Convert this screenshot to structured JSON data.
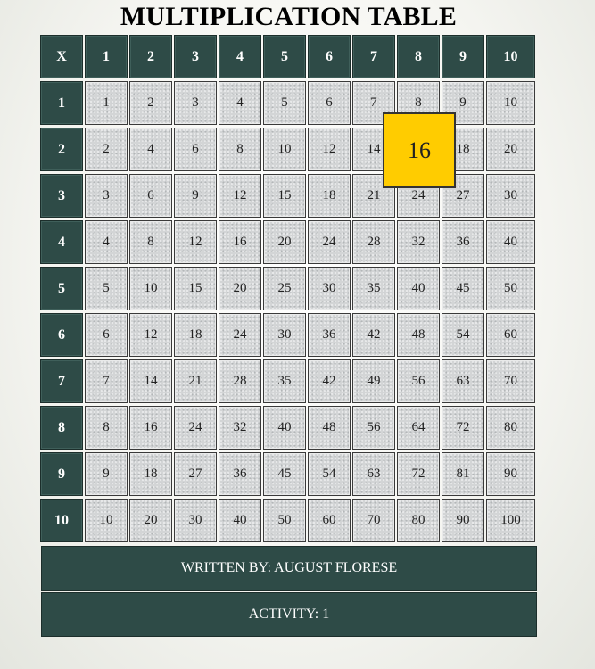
{
  "title": "MULTIPLICATION TABLE",
  "corner_label": "X",
  "column_headers": [
    "1",
    "2",
    "3",
    "4",
    "5",
    "6",
    "7",
    "8",
    "9",
    "10"
  ],
  "row_headers": [
    "1",
    "2",
    "3",
    "4",
    "5",
    "6",
    "7",
    "8",
    "9",
    "10"
  ],
  "rows": [
    [
      "1",
      "2",
      "3",
      "4",
      "5",
      "6",
      "7",
      "8",
      "9",
      "10"
    ],
    [
      "2",
      "4",
      "6",
      "8",
      "10",
      "12",
      "14",
      "16",
      "18",
      "20"
    ],
    [
      "3",
      "6",
      "9",
      "12",
      "15",
      "18",
      "21",
      "24",
      "27",
      "30"
    ],
    [
      "4",
      "8",
      "12",
      "16",
      "20",
      "24",
      "28",
      "32",
      "36",
      "40"
    ],
    [
      "5",
      "10",
      "15",
      "20",
      "25",
      "30",
      "35",
      "40",
      "45",
      "50"
    ],
    [
      "6",
      "12",
      "18",
      "24",
      "30",
      "36",
      "42",
      "48",
      "54",
      "60"
    ],
    [
      "7",
      "14",
      "21",
      "28",
      "35",
      "42",
      "49",
      "56",
      "63",
      "70"
    ],
    [
      "8",
      "16",
      "24",
      "32",
      "40",
      "48",
      "56",
      "64",
      "72",
      "80"
    ],
    [
      "9",
      "18",
      "27",
      "36",
      "45",
      "54",
      "63",
      "72",
      "81",
      "90"
    ],
    [
      "10",
      "20",
      "30",
      "40",
      "50",
      "60",
      "70",
      "80",
      "90",
      "100"
    ]
  ],
  "highlight": {
    "value": "16",
    "row": 1,
    "col": 7
  },
  "footer": {
    "author": "WRITTEN BY: AUGUST FLORESE",
    "activity": "ACTIVITY: 1"
  },
  "colors": {
    "header_bg": "#2e4b47",
    "cell_bg": "#d3d5d6",
    "highlight_bg": "#ffcc00"
  }
}
